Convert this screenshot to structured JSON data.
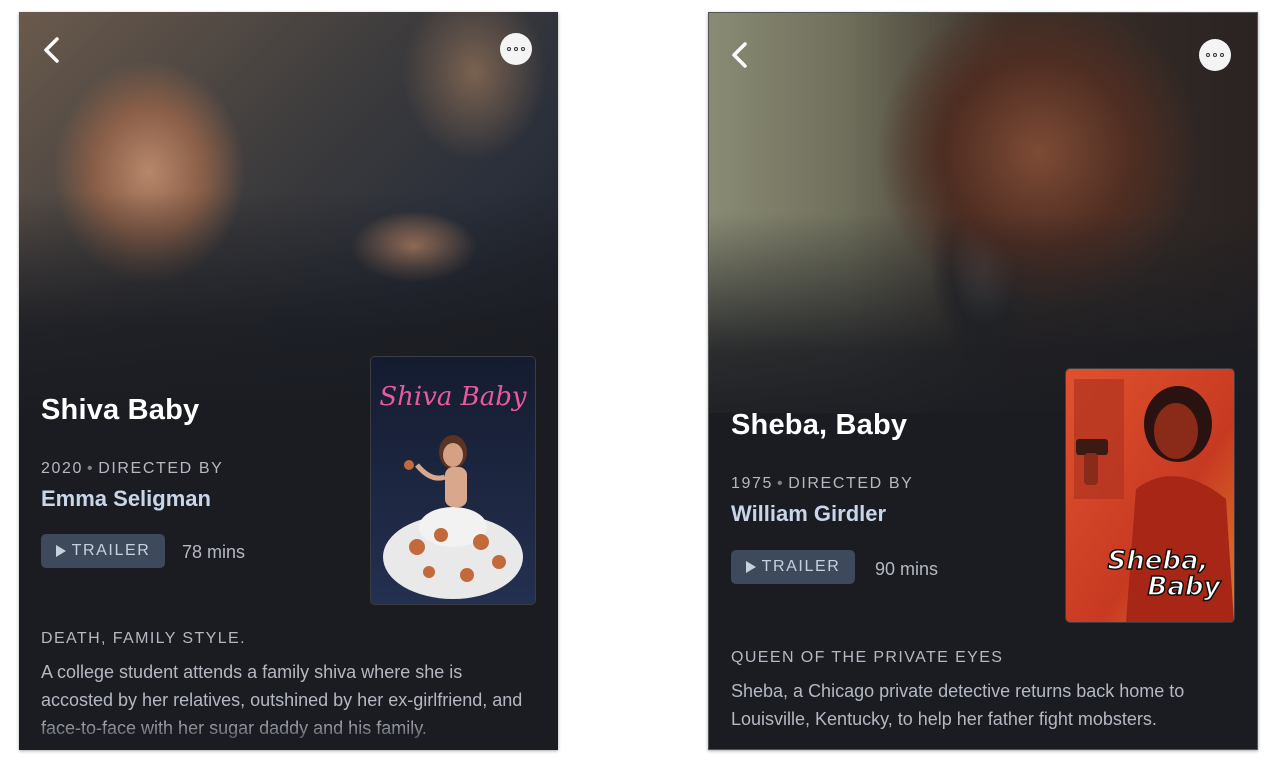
{
  "cards": [
    {
      "title": "Shiva Baby",
      "year": "2020",
      "directed_by_label": "DIRECTED BY",
      "director": "Emma Seligman",
      "trailer_label": "TRAILER",
      "runtime": "78 mins",
      "tagline": "DEATH, FAMILY STYLE.",
      "description": "A college student attends a family shiva where she is accosted by her relatives, outshined by her ex-girlfriend, and face-to-face with her sugar daddy and his family.",
      "poster_title": "Shiva Baby"
    },
    {
      "title": "Sheba, Baby",
      "year": "1975",
      "directed_by_label": "DIRECTED BY",
      "director": "William Girdler",
      "trailer_label": "TRAILER",
      "runtime": "90 mins",
      "tagline": "QUEEN OF THE PRIVATE EYES",
      "description": "Sheba, a Chicago private detective returns back home to Louisville, Kentucky, to help her father fight mobsters.",
      "poster_title_line1": "Sheba,",
      "poster_title_line2": "Baby"
    }
  ],
  "icons": {
    "back": "chevron-left-icon",
    "more": "more-options-icon",
    "play": "play-icon"
  },
  "colors": {
    "card_bg": "#1a1c22",
    "trailer_bg": "#3e4a5c",
    "director_text": "#c9d6ea",
    "muted_text": "#b4b8c2",
    "poster1_title": "#e85aa0",
    "poster2_bg": "#d8442a"
  }
}
